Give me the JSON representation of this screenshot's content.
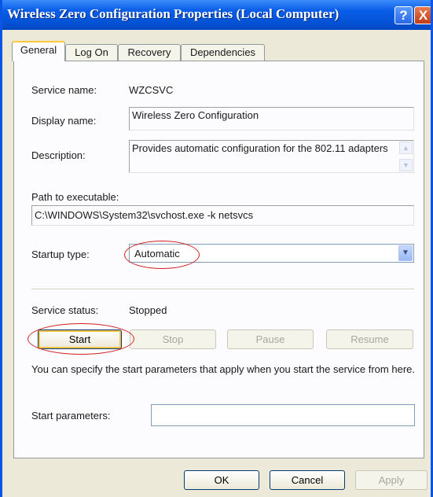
{
  "window": {
    "title": "Wireless Zero Configuration Properties (Local Computer)",
    "help_glyph": "?",
    "close_glyph": "X"
  },
  "tabs": [
    {
      "label": "General",
      "active": true
    },
    {
      "label": "Log On",
      "active": false
    },
    {
      "label": "Recovery",
      "active": false
    },
    {
      "label": "Dependencies",
      "active": false
    }
  ],
  "general": {
    "service_name_label": "Service name:",
    "service_name": "WZCSVC",
    "display_name_label": "Display name:",
    "display_name": "Wireless Zero Configuration",
    "description_label": "Description:",
    "description": "Provides automatic configuration for the 802.11 adapters",
    "path_label": "Path to executable:",
    "path": "C:\\WINDOWS\\System32\\svchost.exe -k netsvcs",
    "startup_type_label": "Startup type:",
    "startup_type": "Automatic",
    "service_status_label": "Service status:",
    "service_status": "Stopped",
    "buttons": {
      "start": "Start",
      "stop": "Stop",
      "pause": "Pause",
      "resume": "Resume"
    },
    "hint": "You can specify the start parameters that apply when you start the service from here.",
    "start_params_label": "Start parameters:",
    "start_params_value": ""
  },
  "footer": {
    "ok": "OK",
    "cancel": "Cancel",
    "apply": "Apply"
  },
  "colors": {
    "titlebar": "#0453d6",
    "annotation": "#d02020",
    "face": "#ece9d8"
  }
}
